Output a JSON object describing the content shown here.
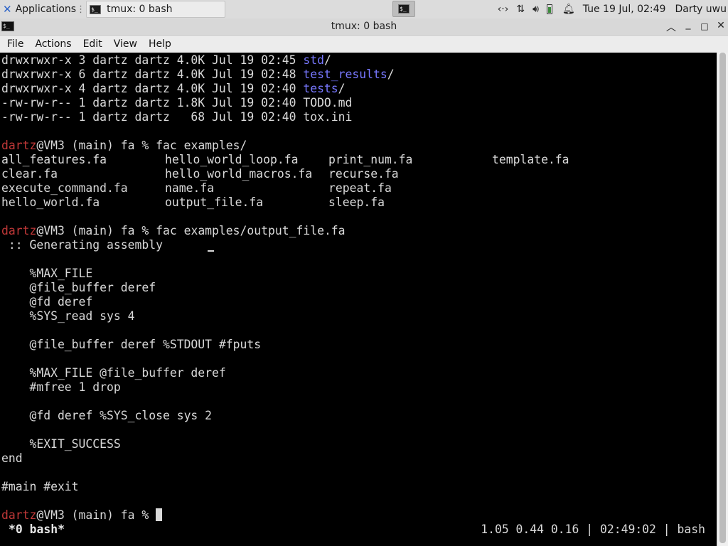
{
  "panel": {
    "apps_label": "Applications",
    "task_label": "tmux: 0 bash",
    "clock": "Tue 19 Jul, 02:49",
    "user": "Darty uwu"
  },
  "window": {
    "title": "tmux: 0 bash"
  },
  "menu": [
    "File",
    "Actions",
    "Edit",
    "View",
    "Help"
  ],
  "terminal": {
    "listing": [
      {
        "perms": "drwxrwxr-x 3 dartz dartz 4.0K Jul 19 02:45 ",
        "name": "std",
        "suffix": "/",
        "is_dir": true
      },
      {
        "perms": "drwxrwxr-x 6 dartz dartz 4.0K Jul 19 02:48 ",
        "name": "test_results",
        "suffix": "/",
        "is_dir": true
      },
      {
        "perms": "drwxrwxr-x 4 dartz dartz 4.0K Jul 19 02:40 ",
        "name": "tests",
        "suffix": "/",
        "is_dir": true
      },
      {
        "perms": "-rw-rw-r-- 1 dartz dartz 1.8K Jul 19 02:40 ",
        "name": "TODO.md",
        "suffix": "",
        "is_dir": false
      },
      {
        "perms": "-rw-rw-r-- 1 dartz dartz   68 Jul 19 02:40 ",
        "name": "tox.ini",
        "suffix": "",
        "is_dir": false
      }
    ],
    "prompt_user": "dartz",
    "prompt_rest": "@VM3 (main) fa % ",
    "cmd1": "fac examples/",
    "examples": [
      [
        "all_features.fa",
        "hello_world_loop.fa",
        "print_num.fa",
        "template.fa"
      ],
      [
        "clear.fa",
        "hello_world_macros.fa",
        "recurse.fa",
        ""
      ],
      [
        "execute_command.fa",
        "name.fa",
        "repeat.fa",
        ""
      ],
      [
        "hello_world.fa",
        "output_file.fa",
        "sleep.fa",
        ""
      ]
    ],
    "cmd2": "fac examples/output_file.fa",
    "output": [
      " :: Generating assembly",
      "",
      "    %MAX_FILE",
      "    @file_buffer deref",
      "    @fd deref",
      "    %SYS_read sys 4",
      "",
      "    @file_buffer deref %STDOUT #fputs",
      "",
      "    %MAX_FILE @file_buffer deref",
      "    #mfree 1 drop",
      "",
      "    @fd deref %SYS_close sys 2",
      "",
      "    %EXIT_SUCCESS",
      "end",
      "",
      "#main #exit",
      ""
    ],
    "status_left": "*0 bash*",
    "status_right": "1.05 0.44 0.16 | 02:49:02 | bash"
  }
}
